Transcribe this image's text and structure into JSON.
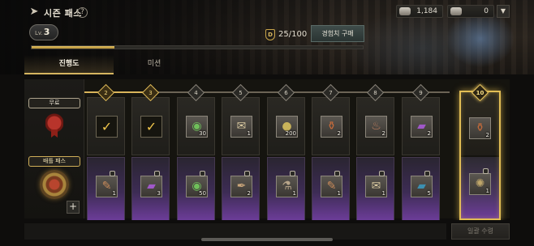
{
  "header": {
    "title": "시즌 패스",
    "help_glyph": "?",
    "back_glyph": "➤",
    "currencies": [
      {
        "icon": "ticket-icon",
        "value": "1,184"
      },
      {
        "icon": "silver-ticket-icon",
        "value": "0"
      }
    ],
    "menu_glyph": "▼"
  },
  "level": {
    "prefix": "Lv.",
    "value": "3"
  },
  "xp": {
    "icon_glyph": "D",
    "text": "25/100",
    "progress": 0.25
  },
  "buy_xp_button": "경험치 구매",
  "tabs": [
    {
      "label": "진행도",
      "active": true
    },
    {
      "label": "미션",
      "active": false
    }
  ],
  "tiers": {
    "free": "무료",
    "battle_pass": "배틀 패스"
  },
  "plus_glyph": "+",
  "claim_all_button": "일괄 수령",
  "columns": [
    {
      "level": "2",
      "done": true,
      "free": {
        "icon": "check-icon",
        "glyph": "✓",
        "qty": "",
        "claimed": true
      },
      "pass": {
        "icon": "flute-icon",
        "glyph": "✎",
        "qty": "1",
        "locked": true
      }
    },
    {
      "level": "3",
      "done": true,
      "free": {
        "icon": "check-icon",
        "glyph": "✓",
        "qty": "",
        "claimed": true
      },
      "pass": {
        "icon": "tome-icon",
        "glyph": "▰",
        "qty": "3",
        "locked": true
      }
    },
    {
      "level": "4",
      "done": false,
      "free": {
        "icon": "green-medallion-icon",
        "glyph": "◉",
        "qty": "30",
        "claimed": false
      },
      "pass": {
        "icon": "green-medallion-icon",
        "glyph": "◉",
        "qty": "50",
        "locked": true
      }
    },
    {
      "level": "5",
      "done": false,
      "free": {
        "icon": "map-scroll-icon",
        "glyph": "✉",
        "qty": "1",
        "claimed": false
      },
      "pass": {
        "icon": "scroll-icon",
        "glyph": "✒",
        "qty": "2",
        "locked": true
      }
    },
    {
      "level": "6",
      "done": false,
      "free": {
        "icon": "gold-coin-icon",
        "glyph": "●",
        "qty": "200",
        "claimed": false
      },
      "pass": {
        "icon": "mortar-icon",
        "glyph": "⚗",
        "qty": "1",
        "locked": true
      }
    },
    {
      "level": "7",
      "done": false,
      "free": {
        "icon": "potion-bottle-icon",
        "glyph": "⚱",
        "qty": "2",
        "claimed": false
      },
      "pass": {
        "icon": "flute-icon",
        "glyph": "✎",
        "qty": "1",
        "locked": true
      }
    },
    {
      "level": "8",
      "done": false,
      "free": {
        "icon": "meat-icon",
        "glyph": "♨",
        "qty": "2",
        "claimed": false
      },
      "pass": {
        "icon": "map-scroll-icon",
        "glyph": "✉",
        "qty": "1",
        "locked": true
      }
    },
    {
      "level": "9",
      "done": false,
      "free": {
        "icon": "tome-icon",
        "glyph": "▰",
        "qty": "2",
        "claimed": false
      },
      "pass": {
        "icon": "blue-tome-icon",
        "glyph": "▰",
        "qty": "5",
        "locked": true
      }
    }
  ],
  "highlight_column": {
    "level": "10",
    "free": {
      "icon": "potion-bottle-icon",
      "glyph": "⚱",
      "qty": "2"
    },
    "pass": {
      "icon": "fan-icon",
      "glyph": "✺",
      "qty": "1",
      "locked": true
    }
  },
  "colors": {
    "accent_gold": "#e1bd55",
    "pass_purple": "#6d3d9a"
  }
}
